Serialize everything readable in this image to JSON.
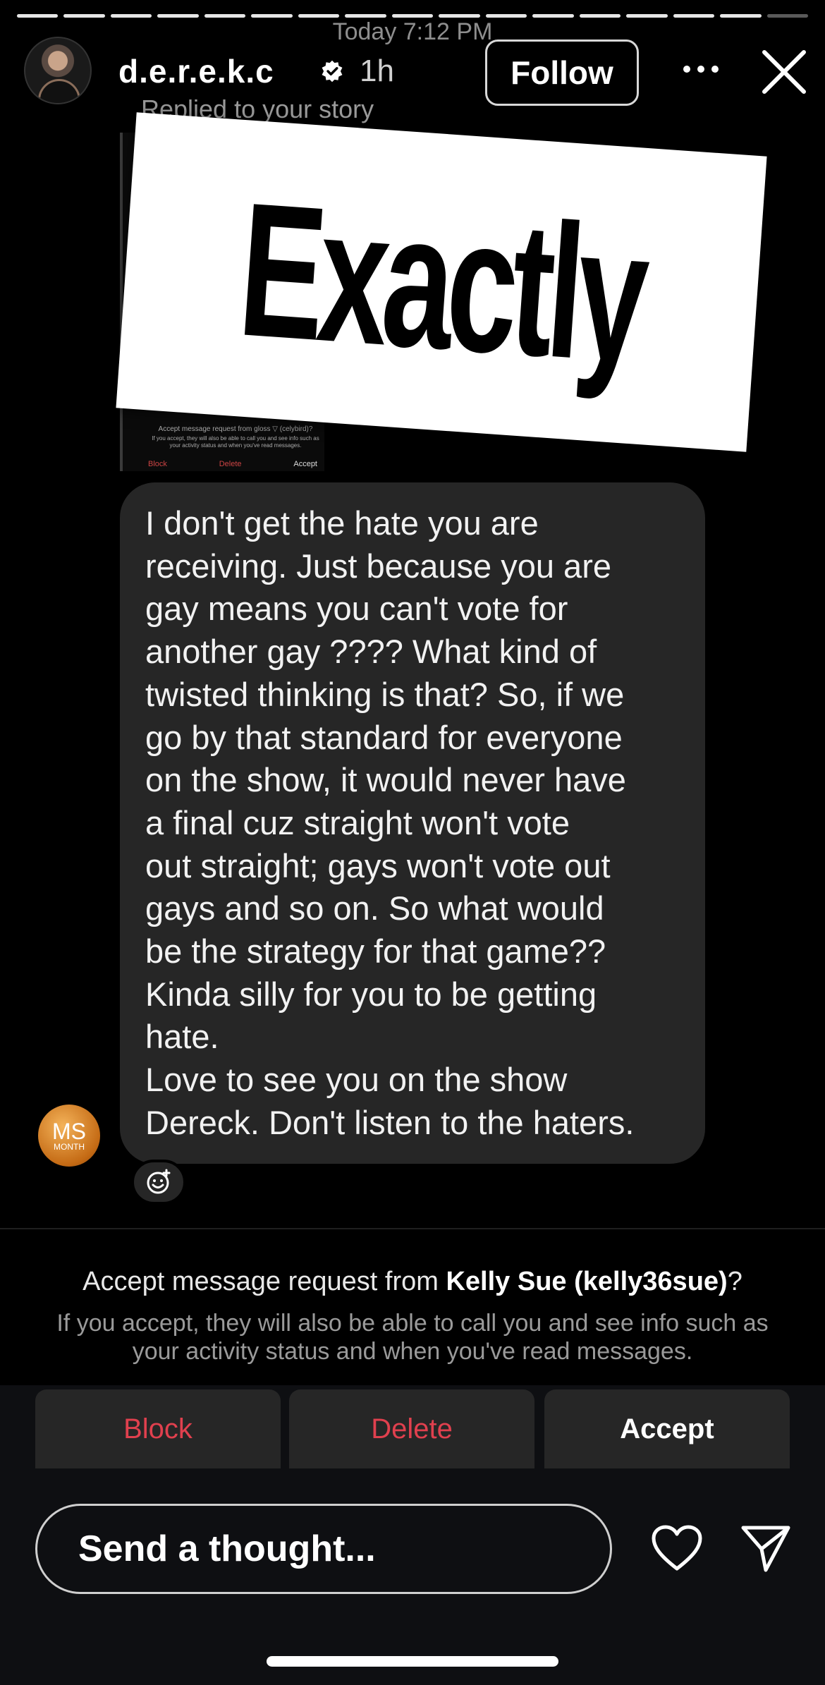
{
  "story": {
    "segments": 17,
    "current": 16
  },
  "header": {
    "timestamp": "Today 7:12 PM",
    "username": "d.e.r.e.k.c",
    "age": "1h",
    "replied": "Replied to your story",
    "follow_label": "Follow",
    "verified_icon": "verified-badge-icon"
  },
  "preview": {
    "sticker_text": "Exactly",
    "mini_request": "Accept message request from gloss ▽ (celybird)?",
    "mini_sub": "If you accept, they will also be able to call you and see info such as your activity status and when you've read messages.",
    "mini_buttons": [
      "Block",
      "Delete",
      "Accept"
    ]
  },
  "message": {
    "text": "I don't get the hate you are\nreceiving. Just because you are\ngay means you can't vote for\nanother gay ???? What kind of\ntwisted thinking is that? So, if we\ngo by that standard for everyone\non the show, it would never have\na final cuz straight won't vote\nout straight; gays won't vote out\ngays and so on. So what would\nbe the strategy for that game??\nKinda silly for you to be getting\nhate.\nLove to see you on the show\nDereck. Don't listen to the haters.",
    "sender_avatar_initials": "MS",
    "sender_avatar_caption": "MONTH"
  },
  "request": {
    "prefix": "Accept message request from ",
    "name": "Kelly Sue (kelly36sue)",
    "suffix": "?",
    "subtitle": "If you accept, they will also be able to call you and see info such as your activity status and when you've read messages."
  },
  "actions": {
    "block": "Block",
    "delete": "Delete",
    "accept": "Accept"
  },
  "composer": {
    "placeholder": "Send a thought..."
  },
  "colors": {
    "danger": "#e0404e",
    "bubble": "#262626",
    "background": "#000000"
  }
}
